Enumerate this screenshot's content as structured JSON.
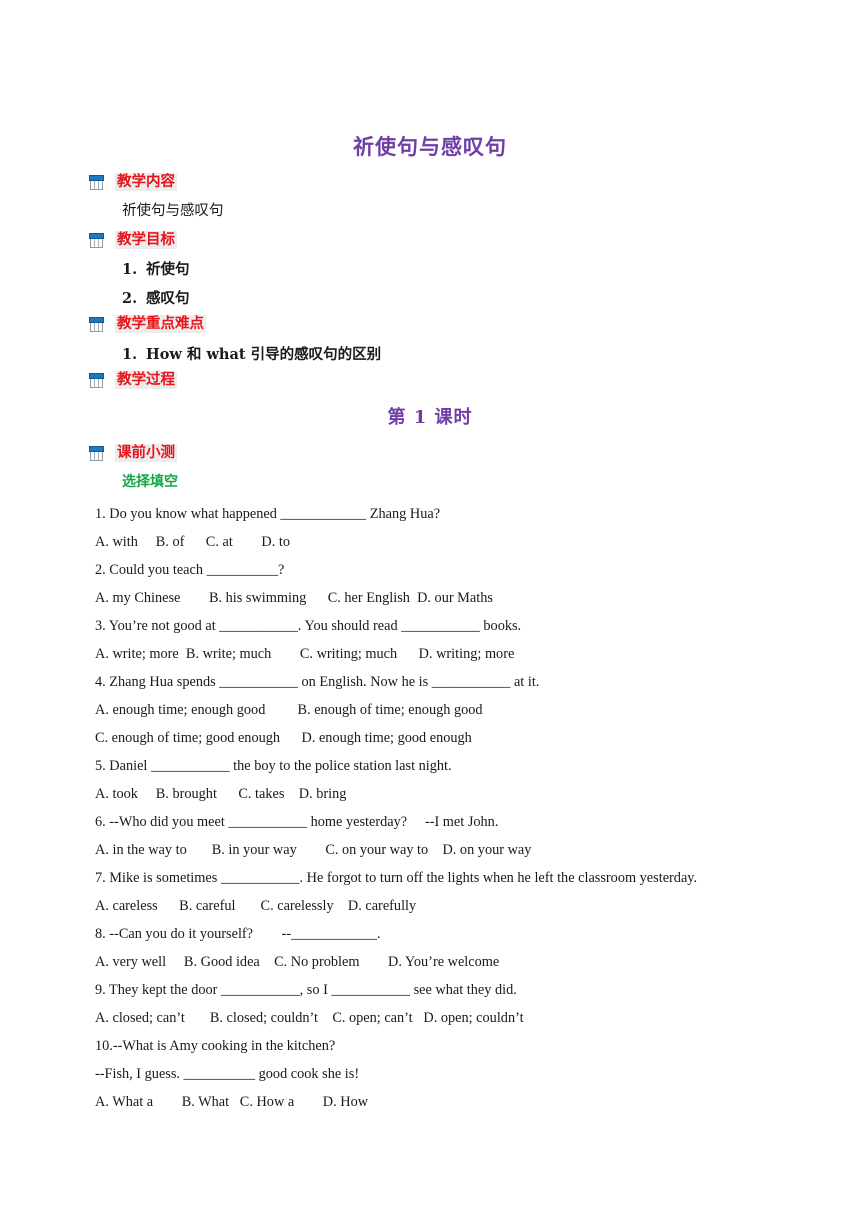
{
  "document": {
    "title": "祈使句与感叹句",
    "session_title": "第 1 课时"
  },
  "sections": [
    {
      "icon": "box-bullet-icon",
      "label": "教学内容",
      "body": "祈使句与感叹句"
    },
    {
      "icon": "box-bullet-icon",
      "label": "教学目标",
      "items": [
        {
          "num": "1.",
          "text": "祈使句"
        },
        {
          "num": "2.",
          "text": "感叹句"
        }
      ]
    },
    {
      "icon": "box-bullet-icon",
      "label": "教学重点难点",
      "items": [
        {
          "num": "1.",
          "text": "How 和 what  引导的感叹句的区别"
        }
      ]
    },
    {
      "icon": "box-bullet-icon",
      "label": "教学过程"
    },
    {
      "icon": "box-bullet-icon",
      "label": "课前小测",
      "subheading": "选择填空"
    }
  ],
  "colors": {
    "title_purple": "#6f3fa5",
    "header_red": "#e8141b",
    "header_highlight": "#ececec",
    "subheading_green": "#17a74a",
    "icon_blue": "#1a7ac4"
  },
  "quiz": {
    "lines": [
      "1. Do you know what happened ____________ Zhang Hua?",
      "A. with     B. of      C. at        D. to",
      "2. Could you teach __________?",
      "A. my Chinese        B. his swimming      C. her English  D. our Maths",
      "3. You’re not good at ___________. You should read ___________ books.",
      "A. write; more  B. write; much        C. writing; much      D. writing; more",
      "4. Zhang Hua spends ___________ on English. Now he is ___________ at it.",
      "A. enough time; enough good         B. enough of time; enough good",
      "C. enough of time; good enough      D. enough time; good enough",
      "5. Daniel ___________ the boy to the police station last night.",
      "A. took     B. brought      C. takes    D. bring",
      "6. --Who did you meet ___________ home yesterday?     --I met John.",
      "A. in the way to       B. in your way        C. on your way to    D. on your way",
      "7. Mike is sometimes ___________. He forgot to turn off the lights when he left the classroom yesterday.",
      "A. careless      B. careful       C. carelessly    D. carefully",
      "8. --Can you do it yourself?        --____________.",
      "A. very well     B. Good idea    C. No problem        D. You’re welcome",
      "9. They kept the door ___________, so I ___________ see what they did.",
      "A. closed; can’t       B. closed; couldn’t    C. open; can’t   D. open; couldn’t",
      "10.--What is Amy cooking in the kitchen?",
      "--Fish, I guess. __________ good cook she is!",
      "A. What a        B. What   C. How a        D. How"
    ]
  }
}
